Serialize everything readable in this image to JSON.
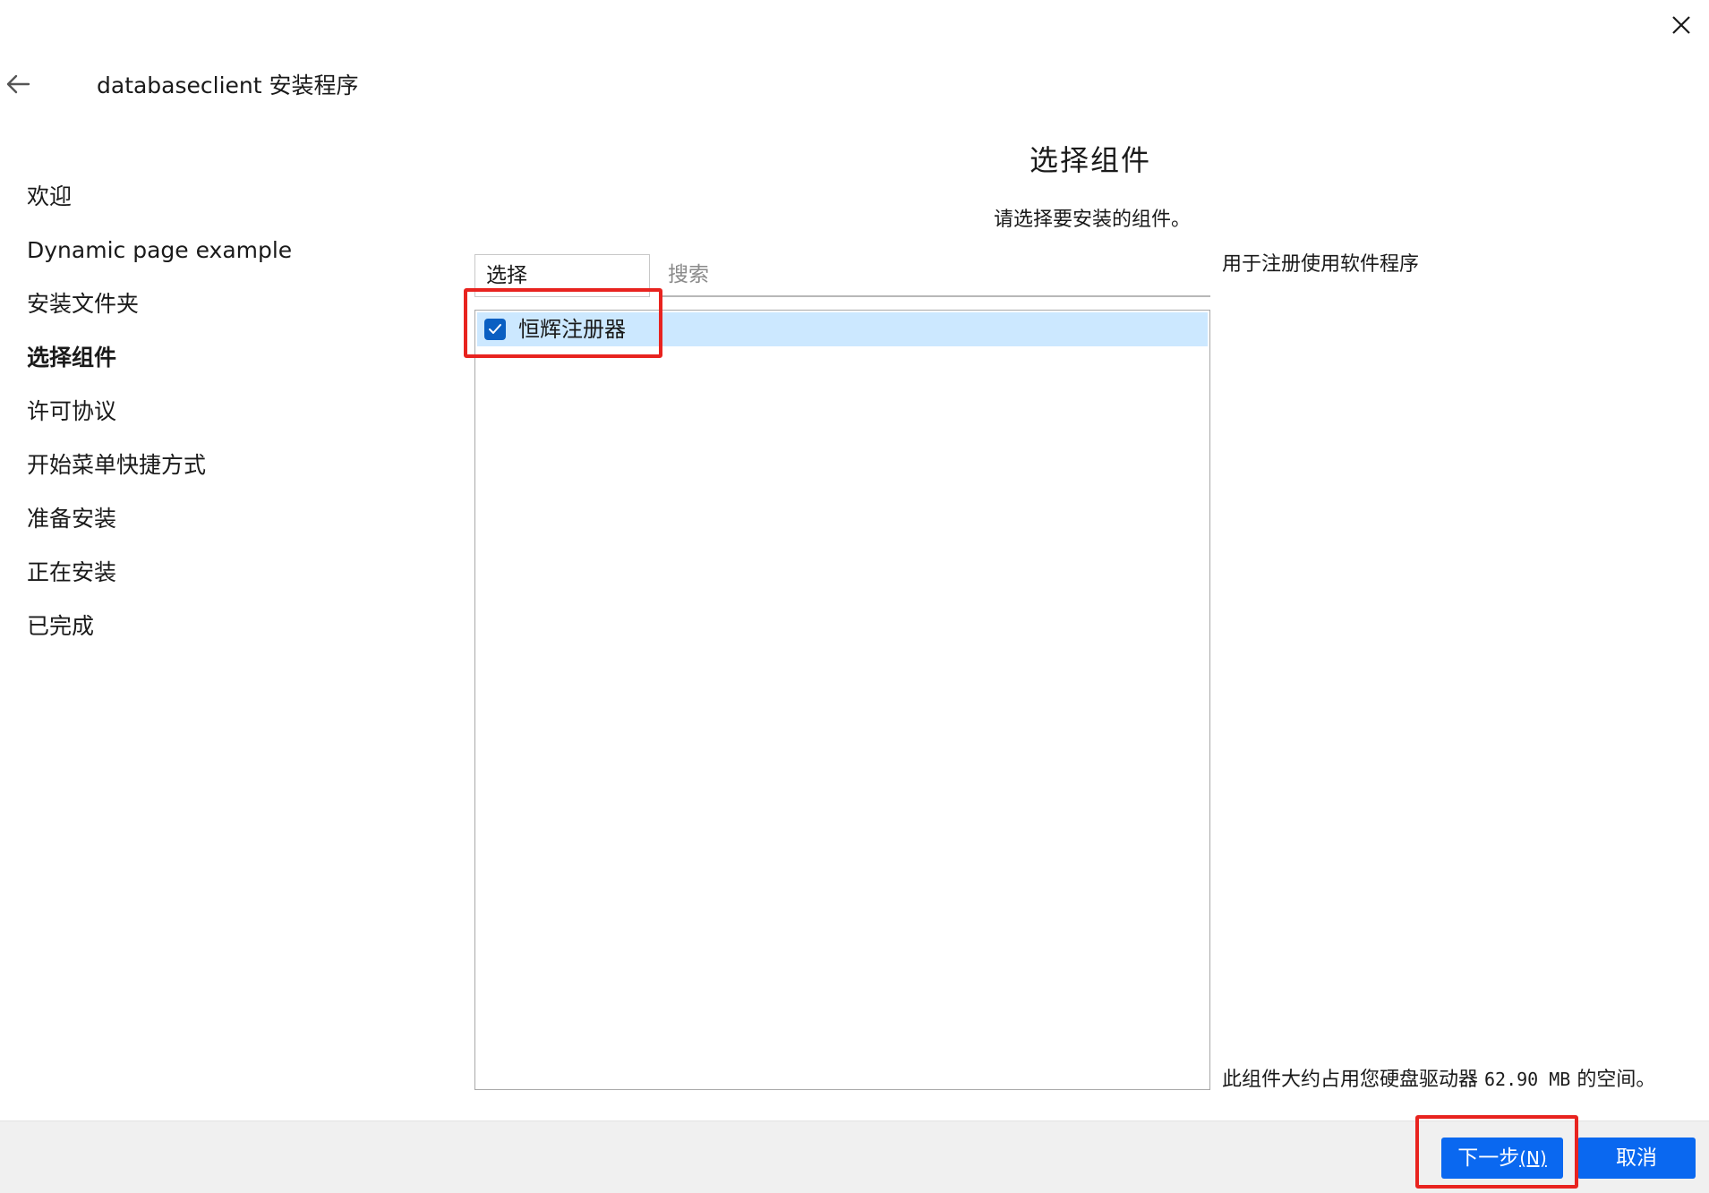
{
  "window": {
    "title": "databaseclient 安装程序",
    "back_icon": "arrow-left-icon",
    "close_icon": "close-icon"
  },
  "steps": [
    {
      "label": "欢迎",
      "active": false
    },
    {
      "label": "Dynamic page example",
      "active": false
    },
    {
      "label": "安装文件夹",
      "active": false
    },
    {
      "label": "选择组件",
      "active": true
    },
    {
      "label": "许可协议",
      "active": false
    },
    {
      "label": "开始菜单快捷方式",
      "active": false
    },
    {
      "label": "准备安装",
      "active": false
    },
    {
      "label": "正在安装",
      "active": false
    },
    {
      "label": "已完成",
      "active": false
    }
  ],
  "main": {
    "title": "选择组件",
    "subtitle": "请选择要安装的组件。",
    "select_header": "选择",
    "search_placeholder": "搜索",
    "components": [
      {
        "label": "恒辉注册器",
        "checked": true
      }
    ],
    "description": "用于注册使用软件程序",
    "space_prefix": "此组件大约占用您硬盘驱动器",
    "space_value": "62.90 MB",
    "space_suffix": "的空间。"
  },
  "footer": {
    "next_label": "下一步",
    "next_accel": "(N)",
    "cancel_label": "取消"
  },
  "colors": {
    "accent": "#0a68f0",
    "checkbox": "#0a5fc2",
    "selection": "#cce8ff",
    "annotation": "#e8231f",
    "footer_bg": "#f0f0f0"
  }
}
